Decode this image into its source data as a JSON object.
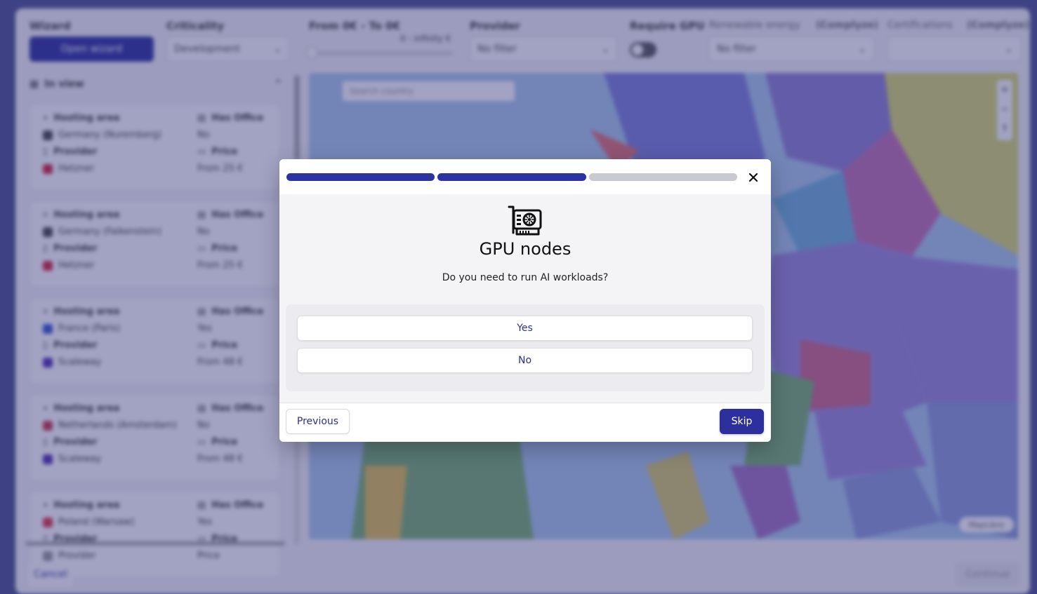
{
  "background": {
    "filters": {
      "wizard_label": "Wizard",
      "wizard_button": "Open wizard",
      "criticality_label": "Criticality",
      "criticality_value": "Development",
      "price_label": "From 0€ - To 0€",
      "price_value": "0 - infinity €",
      "provider_label": "Provider",
      "provider_value": "No filter",
      "gpu_label": "Require GPU",
      "renewable_label": "Renewable energy",
      "renewable_sub": "(Complyze)",
      "renewable_value": "No filter",
      "cert_label": "Certifications",
      "cert_sub": "(Complyze)"
    },
    "sidebar": {
      "header": "In view",
      "cards": [
        {
          "area": "Germany (Nuremberg)",
          "flag": "#444444",
          "office": "No",
          "provider": "Hetzner",
          "provider_color": "#d4223a",
          "price": "From 25 €"
        },
        {
          "area": "Germany (Falkenstein)",
          "flag": "#444444",
          "office": "No",
          "provider": "Hetzner",
          "provider_color": "#d4223a",
          "price": "From 25 €"
        },
        {
          "area": "France (Paris)",
          "flag": "#3355cc",
          "office": "Yes",
          "provider": "Scaleway",
          "provider_color": "#4f2bb0",
          "price": "From 48 €"
        },
        {
          "area": "Netherlands (Amsterdam)",
          "flag": "#cc3344",
          "office": "No",
          "provider": "Scaleway",
          "provider_color": "#4f2bb0",
          "price": "From 48 €"
        },
        {
          "area": "Poland (Warsaw)",
          "flag": "#dd3344",
          "office": "Yes",
          "provider": "Provider",
          "provider_color": "#999999",
          "price": "Price"
        }
      ],
      "labels": {
        "area": "Hosting area",
        "office": "Has Office",
        "provider": "Provider",
        "price": "Price"
      }
    },
    "map": {
      "search_placeholder": "Search country",
      "attribution": "MapLibre",
      "zoom_in": "+",
      "zoom_out": "−",
      "compass": "↑"
    },
    "footer": {
      "cancel": "Cancel",
      "continue": "Continue"
    }
  },
  "modal": {
    "progress": [
      {
        "state": "done"
      },
      {
        "state": "done"
      },
      {
        "state": "todo"
      }
    ],
    "close_icon": "close-icon",
    "icon": "gpu-card-icon",
    "title": "GPU nodes",
    "question": "Do you need to run AI workloads?",
    "options": [
      "Yes",
      "No"
    ],
    "previous_label": "Previous",
    "skip_label": "Skip",
    "colors": {
      "accent": "#2e2f9e",
      "progress_todo": "#c9c9d1",
      "option_text": "#2b2f8f"
    }
  }
}
